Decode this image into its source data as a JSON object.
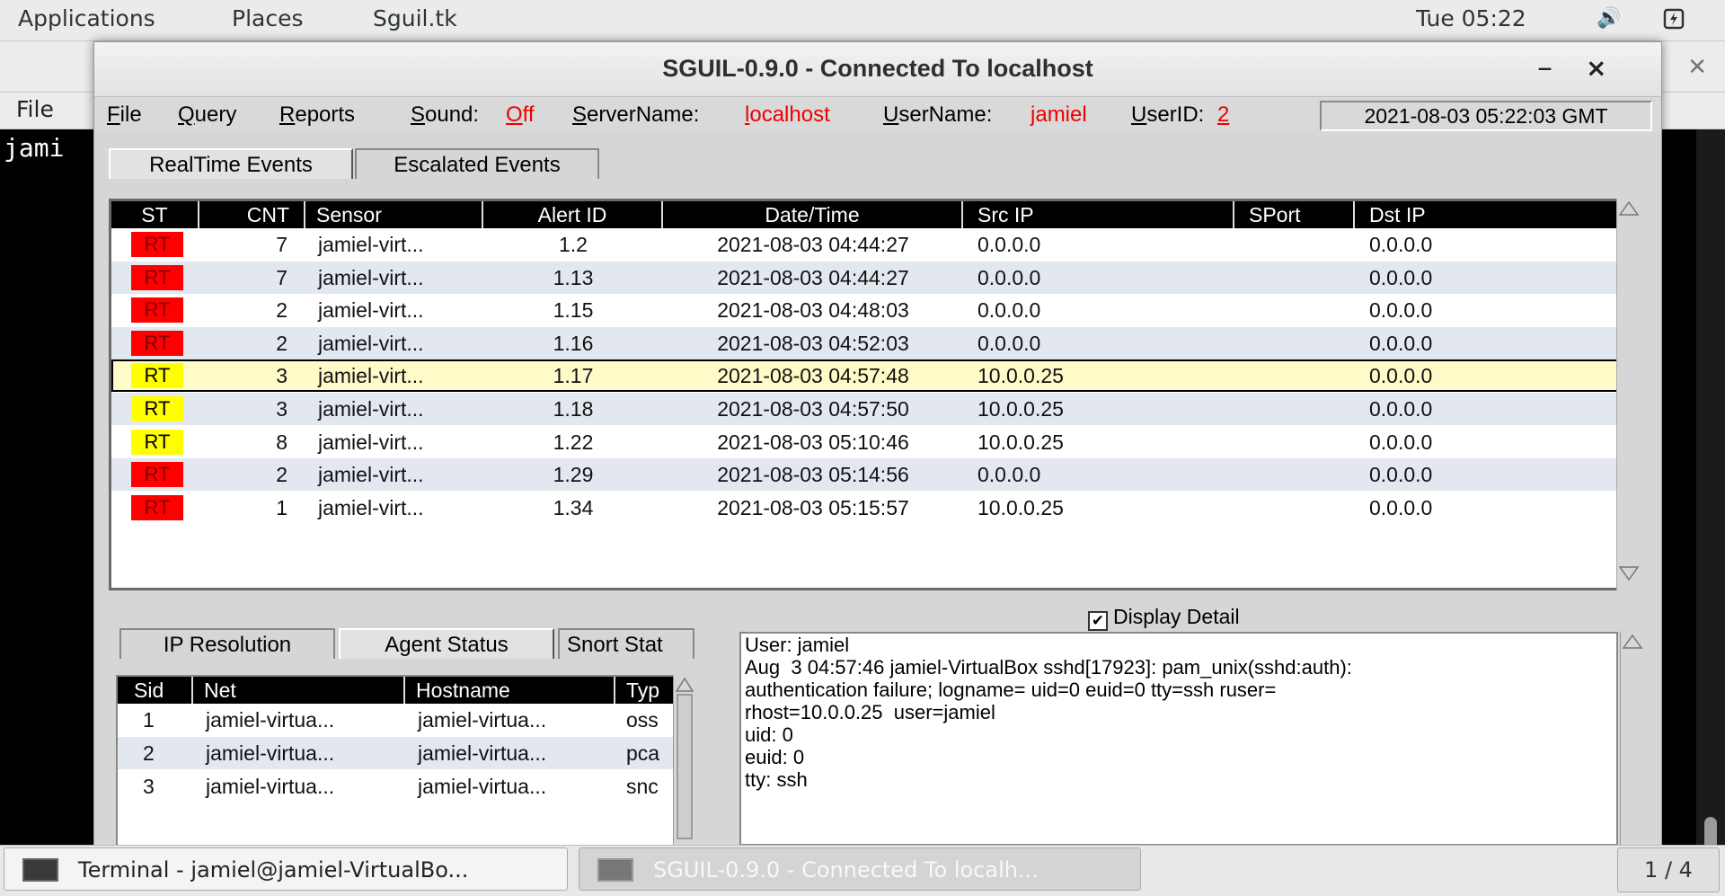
{
  "topbar": {
    "applications": "Applications",
    "places": "Places",
    "app_name": "Sguil.tk",
    "clock": "Tue 05:22"
  },
  "terminal": {
    "menu_file": "File",
    "text": "jami"
  },
  "window": {
    "title": "SGUIL-0.9.0 - Connected To localhost",
    "min": "–",
    "close": "×"
  },
  "menubar": {
    "file": "File",
    "query": "Query",
    "reports": "Reports",
    "sound_label": "Sound:",
    "sound_value": "Off",
    "server_label": "ServerName:",
    "server_value": "localhost",
    "user_label": "UserName:",
    "user_value": "jamiel",
    "userid_label": "UserID:",
    "userid_value": "2",
    "datetime": "2021-08-03 05:22:03 GMT"
  },
  "tabs": [
    "RealTime Events",
    "Escalated Events"
  ],
  "events": {
    "columns": [
      "ST",
      "CNT",
      "Sensor",
      "Alert ID",
      "Date/Time",
      "Src IP",
      "SPort",
      "Dst IP"
    ],
    "rows": [
      {
        "st": "RT",
        "color": "#ff0000",
        "cnt": "7",
        "sensor": "jamiel-virt...",
        "alert": "1.2",
        "dt": "2021-08-03 04:44:27",
        "src": "0.0.0.0",
        "sport": "",
        "dst": "0.0.0.0"
      },
      {
        "st": "RT",
        "color": "#ff0000",
        "cnt": "7",
        "sensor": "jamiel-virt...",
        "alert": "1.13",
        "dt": "2021-08-03 04:44:27",
        "src": "0.0.0.0",
        "sport": "",
        "dst": "0.0.0.0"
      },
      {
        "st": "RT",
        "color": "#ff0000",
        "cnt": "2",
        "sensor": "jamiel-virt...",
        "alert": "1.15",
        "dt": "2021-08-03 04:48:03",
        "src": "0.0.0.0",
        "sport": "",
        "dst": "0.0.0.0"
      },
      {
        "st": "RT",
        "color": "#ff0000",
        "cnt": "2",
        "sensor": "jamiel-virt...",
        "alert": "1.16",
        "dt": "2021-08-03 04:52:03",
        "src": "0.0.0.0",
        "sport": "",
        "dst": "0.0.0.0"
      },
      {
        "st": "RT",
        "color": "#ffff00",
        "cnt": "3",
        "sensor": "jamiel-virt...",
        "alert": "1.17",
        "dt": "2021-08-03 04:57:48",
        "src": "10.0.0.25",
        "sport": "",
        "dst": "0.0.0.0"
      },
      {
        "st": "RT",
        "color": "#ffff00",
        "cnt": "3",
        "sensor": "jamiel-virt...",
        "alert": "1.18",
        "dt": "2021-08-03 04:57:50",
        "src": "10.0.0.25",
        "sport": "",
        "dst": "0.0.0.0"
      },
      {
        "st": "RT",
        "color": "#ffff00",
        "cnt": "8",
        "sensor": "jamiel-virt...",
        "alert": "1.22",
        "dt": "2021-08-03 05:10:46",
        "src": "10.0.0.25",
        "sport": "",
        "dst": "0.0.0.0"
      },
      {
        "st": "RT",
        "color": "#ff0000",
        "cnt": "2",
        "sensor": "jamiel-virt...",
        "alert": "1.29",
        "dt": "2021-08-03 05:14:56",
        "src": "0.0.0.0",
        "sport": "",
        "dst": "0.0.0.0"
      },
      {
        "st": "RT",
        "color": "#ff0000",
        "cnt": "1",
        "sensor": "jamiel-virt...",
        "alert": "1.34",
        "dt": "2021-08-03 05:15:57",
        "src": "10.0.0.25",
        "sport": "",
        "dst": "0.0.0.0"
      }
    ]
  },
  "lower_tabs": [
    "IP Resolution",
    "Agent Status",
    "Snort Stat"
  ],
  "agents": {
    "columns": [
      "Sid",
      "Net",
      "Hostname",
      "Typ"
    ],
    "rows": [
      {
        "sid": "1",
        "net": "jamiel-virtua...",
        "host": "jamiel-virtua...",
        "type": "oss"
      },
      {
        "sid": "2",
        "net": "jamiel-virtua...",
        "host": "jamiel-virtua...",
        "type": "pca"
      },
      {
        "sid": "3",
        "net": "jamiel-virtua...",
        "host": "jamiel-virtua...",
        "type": "snc"
      }
    ]
  },
  "detail": {
    "checkbox_label": "Display Detail",
    "check": "✔",
    "lines": [
      "User: jamiel",
      "Aug  3 04:57:46 jamiel-VirtualBox sshd[17923]: pam_unix(sshd:auth):",
      "authentication failure; logname= uid=0 euid=0 tty=ssh ruser=",
      "rhost=10.0.0.25  user=jamiel",
      "uid: 0",
      "euid: 0",
      "tty: ssh"
    ]
  },
  "taskbar": {
    "terminal": "Terminal - jamiel@jamiel-VirtualBo...",
    "sguil": "SGUIL-0.9.0 - Connected To localh...",
    "pager": "1 / 4"
  },
  "icons": {
    "volume": "speaker-icon",
    "battery": "battery-icon"
  }
}
